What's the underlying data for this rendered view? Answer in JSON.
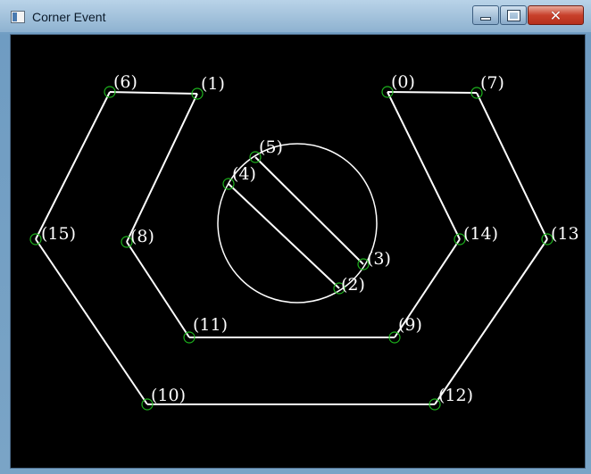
{
  "window": {
    "title": "Corner Event",
    "close_symbol": "✕"
  },
  "icons": {
    "app": "app-window-icon",
    "minimize": "minimize-icon",
    "maximize": "maximize-icon",
    "close": "close-icon"
  },
  "colors": {
    "canvas_background": "#000000",
    "edge_lines": "#ffffff",
    "corner_marker": "#1db31d",
    "label_text": "#ffffff"
  },
  "corners": [
    {
      "id": "0",
      "label": "(0)"
    },
    {
      "id": "1",
      "label": "(1)"
    },
    {
      "id": "2",
      "label": "(2)"
    },
    {
      "id": "3",
      "label": "(3)"
    },
    {
      "id": "4",
      "label": "(4)"
    },
    {
      "id": "5",
      "label": "(5)"
    },
    {
      "id": "6",
      "label": "(6)"
    },
    {
      "id": "7",
      "label": "(7)"
    },
    {
      "id": "8",
      "label": "(8)"
    },
    {
      "id": "9",
      "label": "(9)"
    },
    {
      "id": "10",
      "label": "(10)"
    },
    {
      "id": "11",
      "label": "(11)"
    },
    {
      "id": "12",
      "label": "(12)"
    },
    {
      "id": "13",
      "label": "(13"
    },
    {
      "id": "14",
      "label": "(14)"
    },
    {
      "id": "15",
      "label": "(15)"
    }
  ]
}
